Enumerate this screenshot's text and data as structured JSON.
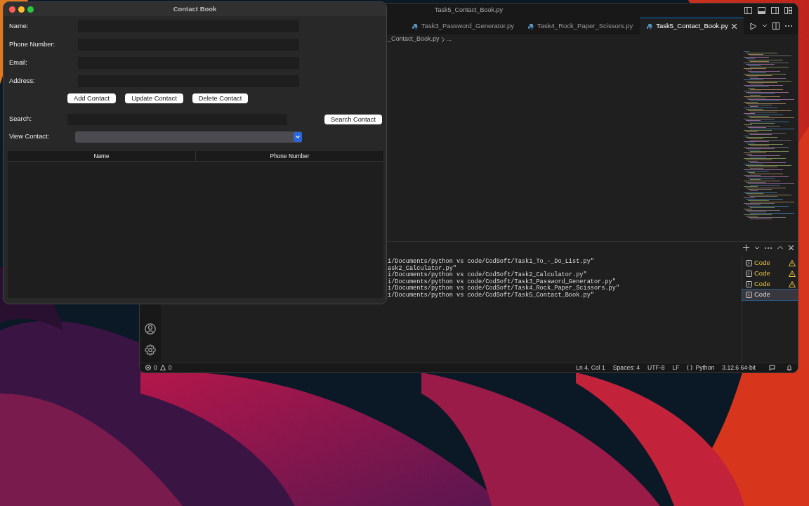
{
  "contact_window": {
    "title": "Contact Book",
    "fields": [
      {
        "label": "Name:"
      },
      {
        "label": "Phone Number:"
      },
      {
        "label": "Email:"
      },
      {
        "label": "Address:"
      }
    ],
    "buttons": [
      "Add Contact",
      "Update Contact",
      "Delete Contact"
    ],
    "search": {
      "label": "Search:",
      "button": "Search Contact"
    },
    "view_contact": {
      "label": "View Contact:"
    },
    "table": {
      "columns": [
        "Name",
        "Phone Number"
      ]
    }
  },
  "editor_window": {
    "title": "Task5_Contact_Book.py",
    "tabs": [
      {
        "label": "Task3_Password_Generator.py",
        "selected": false
      },
      {
        "label": "Task4_Rock_Paper_Scissors.py",
        "selected": false
      },
      {
        "label": "Task5_Contact_Book.py",
        "selected": true
      }
    ],
    "breadcrumb": [
      "_Contact_Book.py",
      "..."
    ],
    "terminal_lines": [
      "i/Documents/python vs code/CodSoft/Task1_To_-_Do_List.py\"",
      "ask2_Calculator.py\"",
      "i/Documents/python vs code/CodSoft/Task2_Calculator.py\"",
      "i/Documents/python vs code/CodSoft/Task3_Password_Generator.py\"",
      "i/Documents/python vs code/CodSoft/Task4_Rock_Paper_Scissors.py\"",
      "i/Documents/python vs code/CodSoft/Task5_Contact_Book.py\""
    ],
    "terminals": [
      {
        "label": "Code",
        "warning": true,
        "selected": false
      },
      {
        "label": "Code",
        "warning": true,
        "selected": false
      },
      {
        "label": "Code",
        "warning": true,
        "selected": false
      },
      {
        "label": "Code",
        "warning": false,
        "selected": true
      }
    ],
    "status_bar": {
      "errors": "0",
      "warnings": "0",
      "items": [
        "Ln 4, Col 1",
        "Spaces: 4",
        "UTF-8",
        "LF",
        "Python",
        "3.12.6 64-bit"
      ]
    }
  }
}
